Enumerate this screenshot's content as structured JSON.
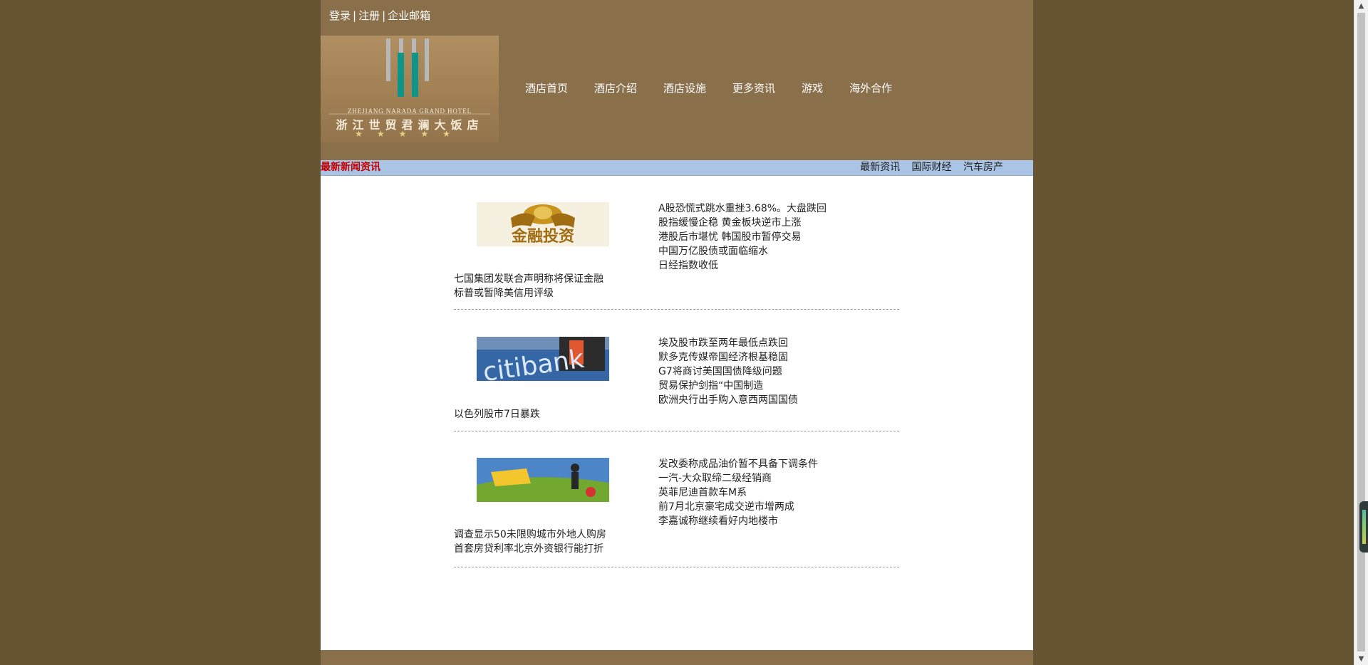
{
  "top_links": [
    "登录",
    "注册",
    "企业邮箱"
  ],
  "top_links_separator": "|",
  "logo": {
    "english": "ZHEJIANG NARADA GRAND HOTEL",
    "chinese": "浙江世贸君澜大饭店",
    "stars": "★★★★★"
  },
  "nav": [
    "酒店首页",
    "酒店介绍",
    "酒店设施",
    "更多资讯",
    "游戏",
    "海外合作"
  ],
  "news_bar": {
    "title": "最新新闻资讯",
    "links": [
      "最新资讯",
      "国际财经",
      "汽车房产"
    ]
  },
  "blocks": [
    {
      "image": "finance-investment-image",
      "image_text": "金融投资",
      "right": [
        "A股恐慌式跳水重挫3.68%。大盘跌回",
        "股指缓慢企稳 黄金板块逆市上涨",
        "港股后市堪忧 韩国股市暂停交易",
        "中国万亿股债或面临缩水",
        "日经指数收低"
      ],
      "left": [
        "七国集团发联合声明称将保证金融",
        "标普或暂降美信用评级"
      ]
    },
    {
      "image": "citibank-image",
      "image_text": "citibank",
      "right": [
        "埃及股市跌至两年最低点跌回",
        "默多克传媒帝国经济根基稳固",
        "G7将商讨美国国债降级问题",
        "贸易保护剑指“中国制造",
        "欧洲央行出手购入意西两国国债"
      ],
      "left": [
        "以色列股市7日暴跌"
      ]
    },
    {
      "image": "real-estate-image",
      "image_text": "",
      "right": [
        "发改委称成品油价暂不具备下调条件",
        "一汽-大众取缔二级经销商",
        "英菲尼迪首款车M系",
        "前7月北京豪宅成交逆市增两成",
        "李嘉诚称继续看好内地楼市"
      ],
      "left": [
        "调查显示50未限购城市外地人购房",
        "首套房贷利率北京外资银行能打折"
      ]
    }
  ],
  "colors": {
    "outer_background": "#665433",
    "header_background": "#8a6f4b",
    "news_bar": "#a9c4e4",
    "news_bar_title": "#c40000"
  }
}
